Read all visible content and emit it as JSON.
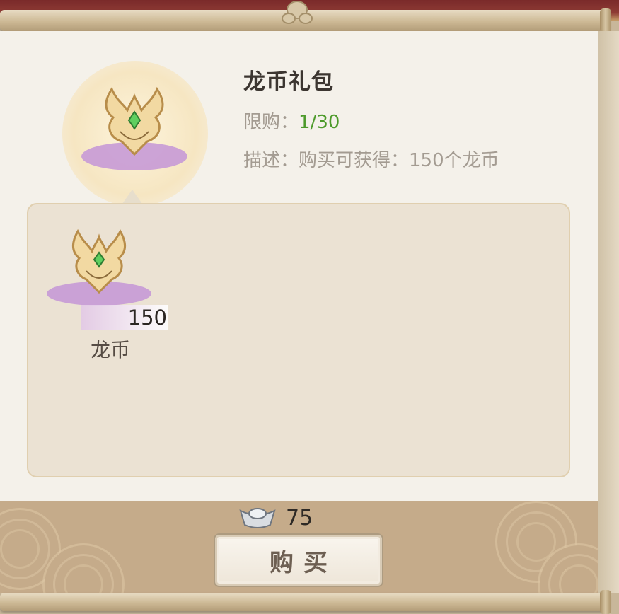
{
  "item": {
    "title": "龙币礼包",
    "limit_label": "限购：",
    "limit_value": "1/30",
    "desc_label": "描述：",
    "desc_text": "购买可获得：150个龙币",
    "icon": "dragon-coin-icon"
  },
  "rewards": [
    {
      "icon": "dragon-coin-icon",
      "count": "150",
      "name": "龙币"
    }
  ],
  "price": {
    "icon": "silver-ingot-icon",
    "value": "75"
  },
  "buy_button": {
    "label": "购买"
  },
  "colors": {
    "limit_value": "#4c9a2a",
    "panel": "#f4f1ea",
    "footer": "#c5ab8a"
  }
}
